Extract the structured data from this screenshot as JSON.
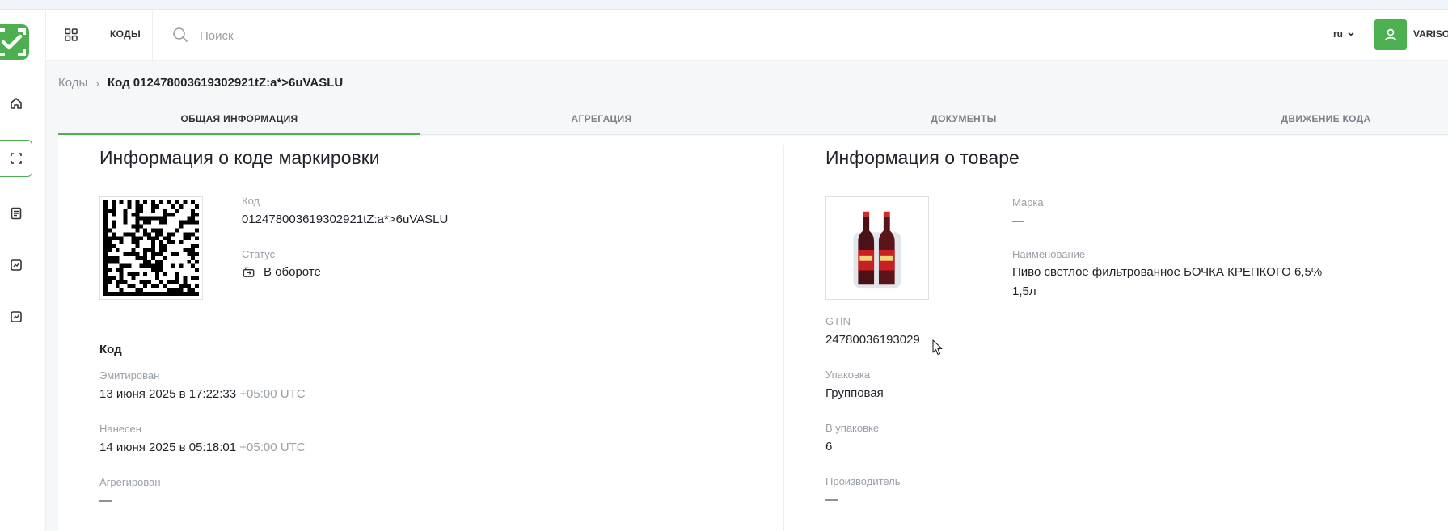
{
  "header": {
    "section_label": "КОДЫ",
    "search_placeholder": "Поиск",
    "language": "ru",
    "user_name": "VARISOV"
  },
  "breadcrumb": {
    "parent": "Коды",
    "current": "Код 0124780036193029​21tZ:a*>6uVASLU"
  },
  "tabs": [
    {
      "label": "ОБЩАЯ ИНФОРМАЦИЯ",
      "active": true
    },
    {
      "label": "АГРЕГАЦИЯ",
      "active": false
    },
    {
      "label": "ДОКУМЕНТЫ",
      "active": false
    },
    {
      "label": "ДВИЖЕНИЕ КОДА",
      "active": false
    }
  ],
  "code_info": {
    "title": "Информация о коде маркировки",
    "code_label": "Код",
    "code_value": "0124780036193029​21tZ:a*>6uVASLU",
    "status_label": "Статус",
    "status_value": "В обороте",
    "section_title": "Код",
    "emitted_label": "Эмитирован",
    "emitted_value": "13 июня 2025 в 17:22:33",
    "emitted_tz": "+05:00 UTC",
    "applied_label": "Нанесен",
    "applied_value": "14 июня 2025 в 05:18:01",
    "applied_tz": "+05:00 UTC",
    "aggregated_label": "Агрегирован",
    "aggregated_value": "—"
  },
  "product_info": {
    "title": "Информация о товаре",
    "brand_label": "Марка",
    "brand_value": "—",
    "name_label": "Наименование",
    "name_line1": "Пиво светлое фильтрованное БОЧКА КРЕПКОГО 6,5%",
    "name_line2": "1,5л",
    "gtin_label": "GTIN",
    "gtin_value": "24780036193029",
    "package_label": "Упаковка",
    "package_value": "Групповая",
    "in_package_label": "В упаковке",
    "in_package_value": "6",
    "producer_label": "Производитель",
    "producer_value": "—"
  },
  "colors": {
    "accent": "#4caf50",
    "text": "#1f2329",
    "muted": "#9aa0a8"
  },
  "icons": {
    "logo": "check-frame-icon",
    "nav": [
      "home-icon",
      "scan-frame-icon",
      "document-icon",
      "report-icon",
      "report-icon"
    ],
    "search": "search-icon",
    "user": "user-icon",
    "status": "circulation-icon"
  }
}
